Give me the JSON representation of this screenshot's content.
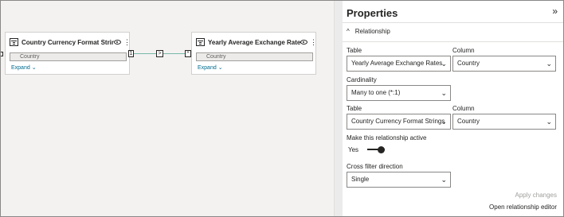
{
  "diagram": {
    "table_left": {
      "title": "Country Currency Format Strings",
      "field": "Country",
      "expand": "Expand"
    },
    "table_right": {
      "title": "Yearly Average Exchange Rates",
      "field": "Country",
      "expand": "Expand"
    },
    "relationship": {
      "from_cardinality": "1",
      "to_cardinality": "*",
      "direction": ">"
    }
  },
  "panel": {
    "title": "Properties",
    "collapse_icon": "»",
    "section": "Relationship",
    "table1_label": "Table",
    "table1_value": "Yearly Average Exchange Rates",
    "column1_label": "Column",
    "column1_value": "Country",
    "cardinality_label": "Cardinality",
    "cardinality_value": "Many to one (*:1)",
    "table2_label": "Table",
    "table2_value": "Country Currency Format Strings",
    "column2_label": "Column",
    "column2_value": "Country",
    "active_label": "Make this relationship active",
    "active_value": "Yes",
    "crossfilter_label": "Cross filter direction",
    "crossfilter_value": "Single",
    "apply_label": "Apply changes",
    "editor_label": "Open relationship editor"
  }
}
